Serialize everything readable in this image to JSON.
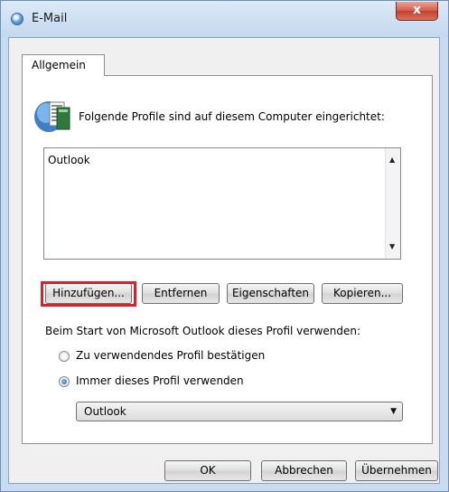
{
  "window": {
    "title": "E-Mail",
    "close_glyph": "x"
  },
  "tabs": [
    {
      "label": "Allgemein"
    }
  ],
  "general": {
    "info_text": "Folgende Profile sind auf diesem Computer eingerichtet:",
    "profiles": [
      "Outlook"
    ],
    "buttons": {
      "add": "Hinzufügen...",
      "remove": "Entfernen",
      "properties": "Eigenschaften",
      "copy": "Kopieren..."
    },
    "startup_text": "Beim Start von Microsoft Outlook dieses Profil verwenden:",
    "radio_confirm": "Zu verwendendes Profil bestätigen",
    "radio_always": "Immer dieses Profil verwenden",
    "selected_profile": "Outlook"
  },
  "footer": {
    "ok": "OK",
    "cancel": "Abbrechen",
    "apply": "Übernehmen"
  },
  "icons": {
    "app": "mail-globe-icon",
    "profile": "profile-list-icon"
  },
  "colors": {
    "highlight": "#e01e2a",
    "close_button": "#c8412e"
  }
}
